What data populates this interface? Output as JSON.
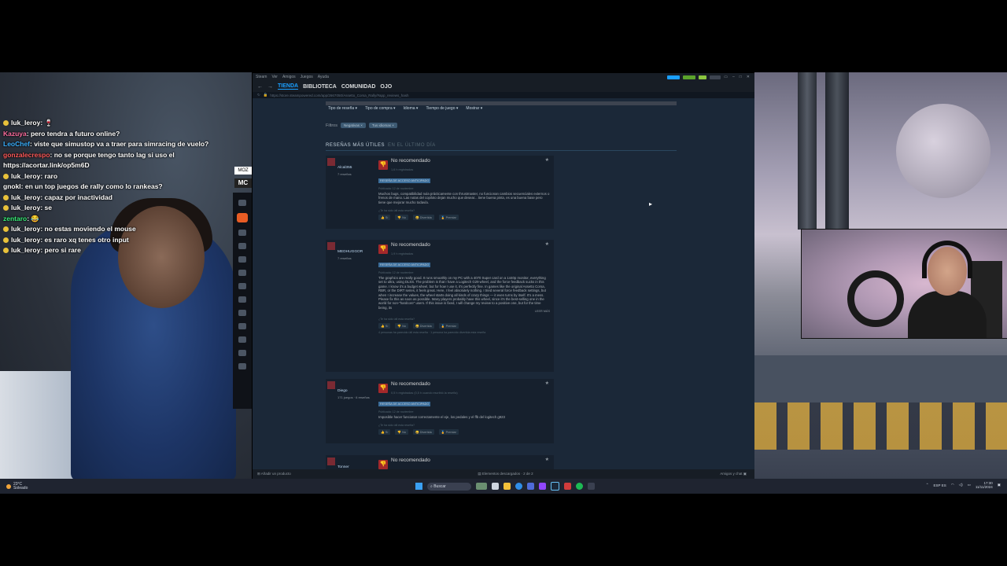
{
  "chat": {
    "lines": [
      {
        "user": "luk_leroy",
        "text": ": 🍷",
        "color": "#ffffff",
        "badge": true
      },
      {
        "user": "Kazuya",
        "text": ": pero tendra a futuro online?",
        "color": "#ff6ea0",
        "badge": false
      },
      {
        "user": "LeoChef",
        "text": ": viste que simustop va a traer para simracing de vuelo?",
        "color": "#3ab0ff",
        "badge": false
      },
      {
        "user": "gonzalecrespo",
        "text": ": no se porque tengo tanto lag si uso el https://acortar.link/op5m6D",
        "color": "#ff5a5a",
        "badge": false
      },
      {
        "user": "luk_leroy",
        "text": ": raro",
        "color": "#ffffff",
        "badge": true
      },
      {
        "user": "gnokl",
        "text": ": en un top juegos de rally como lo rankeas?",
        "color": "#ffffff",
        "badge": false
      },
      {
        "user": "luk_leroy",
        "text": ": capaz por inactividad",
        "color": "#ffffff",
        "badge": true
      },
      {
        "user": "luk_leroy",
        "text": ": se",
        "color": "#ffffff",
        "badge": true
      },
      {
        "user": "zentaro",
        "text": ": 😂",
        "color": "#3af07a",
        "badge": false
      },
      {
        "user": "luk_leroy",
        "text": ": no estas moviendo el mouse",
        "color": "#ffffff",
        "badge": true
      },
      {
        "user": "luk_leroy",
        "text": ": es raro xq tenes otro input",
        "color": "#ffffff",
        "badge": true
      },
      {
        "user": "luk_leroy",
        "text": ": pero si rare",
        "color": "#ffffff",
        "badge": true
      }
    ]
  },
  "mini_overlay": {
    "logo_top": "MOZ",
    "logo_bottom": "MC"
  },
  "steam": {
    "titlebar": {
      "items": [
        "Steam",
        "Ver",
        "Amigos",
        "Juegos",
        "Ayuda"
      ]
    },
    "nav": {
      "tabs": [
        "TIENDA",
        "BIBLIOTECA",
        "COMUNIDAD",
        "OJO"
      ],
      "active": "TIENDA"
    },
    "url": "https://store.steampowered.com/app/2667050/Assetto_Corsa_Rally/#app_reviews_hash",
    "filters": {
      "dropdowns": [
        "Tipo de reseña ▾",
        "Tipo de compra ▾",
        "Idioma ▾",
        "Tiempo de juego ▾",
        "Mostrar ▾"
      ],
      "label": "Filtros",
      "chips": [
        "Negativas ×",
        "Tus idiomas ×"
      ]
    },
    "section": {
      "title": "RESEÑAS MÁS ÚTILES",
      "subtitle": "EN EL ÚLTIMO DÍA"
    },
    "reviews": [
      {
        "name": "Alcal355",
        "meta": "7 reseñas",
        "verdict": "No recomendado",
        "hours": "1,6 h registradas",
        "early": "RESEÑA DE ACCESO ANTICIPADO",
        "posted": "Publicada: 12 de noviembre",
        "body": "Muchos bugs, compatibilidad nula prácticamente con thrustmaster, no funcionan cambios secuenciales externos o frenos de mano. Las notas del copiloto dejan mucho que desear... tiene buena pinta, es una buena base pero tiene que mejorar mucho todavía.",
        "helpful": "¿Te ha sido útil esta reseña?",
        "votes": [
          "👍 Sí",
          "👎 No",
          "😀 Divertida",
          "🏅 Premiar"
        ],
        "extra": ""
      },
      {
        "name": "MEDHUGGOR",
        "meta": "7 reseñas",
        "verdict": "No recomendado",
        "hours": "1,9 h registradas",
        "early": "RESEÑA DE ACCESO ANTICIPADO",
        "posted": "Publicada: 12 de noviembre",
        "body": "The graphics are really good. It runs smoothly on my PC with a 4070 Super card on a 1440p monitor, everything set to ultra, using DLSS. The problem is that I have a Logitech G29 wheel, and the force feedback sucks in this game. I know it's a budget wheel, but for how I use it, it's perfectly fine. In games like the original Assetto Corsa, RBR, or the DiRT series, it feels great. Here, I feel absolutely nothing. I tried several force feedback settings, but when I increase the values, the wheel starts doing all kinds of crazy things — it even turns by itself. It's a mess. Please fix this as soon as possible. Many players probably have this wheel, since it's the best-selling one in the world for non-\"hardcore\" users. If this issue is fixed, I will change my review to a positive one, but for the time being, its",
        "helpful": "¿Te ha sido útil esta reseña?",
        "votes": [
          "👍 Sí",
          "👎 No",
          "😀 Divertida",
          "🏅 Premiar"
        ],
        "extra": "4 personas ha parecido útil esta reseña · 1 persona ha parecido divertida esta reseña",
        "more": "LEER MÁS"
      },
      {
        "name": "Diego",
        "meta": "171 juegos · 6 reseñas",
        "verdict": "No recomendado",
        "hours": "0,5 h registradas (0,5 h cuando escribió la reseña)",
        "early": "RESEÑA DE ACCESO ANTICIPADO",
        "posted": "Publicada: 12 de noviembre",
        "body": "Imposible hacer funcionar correctamente el eje, los pedales y el ffb del logitech g923",
        "helpful": "¿Te ha sido útil esta reseña?",
        "votes": [
          "👍 Sí",
          "👎 No",
          "😀 Divertida",
          "🏅 Premiar"
        ],
        "extra": ""
      },
      {
        "name": "Tonner",
        "meta": "43 reseñas",
        "verdict": "No recomendado",
        "hours": "",
        "early": "",
        "posted": "",
        "body": "",
        "helpful": "",
        "votes": [],
        "extra": ""
      }
    ],
    "status": {
      "left": "Añadir un producto",
      "center": "Elementos descargados · 2 de 2",
      "right": "Amigos y chat"
    }
  },
  "taskbar": {
    "weather": {
      "temp": "23°C",
      "desc": "Soleado"
    },
    "search_placeholder": "Buscar",
    "tray": {
      "lang": "ESP ES",
      "time": "17:30",
      "date": "11/11/2024"
    }
  }
}
